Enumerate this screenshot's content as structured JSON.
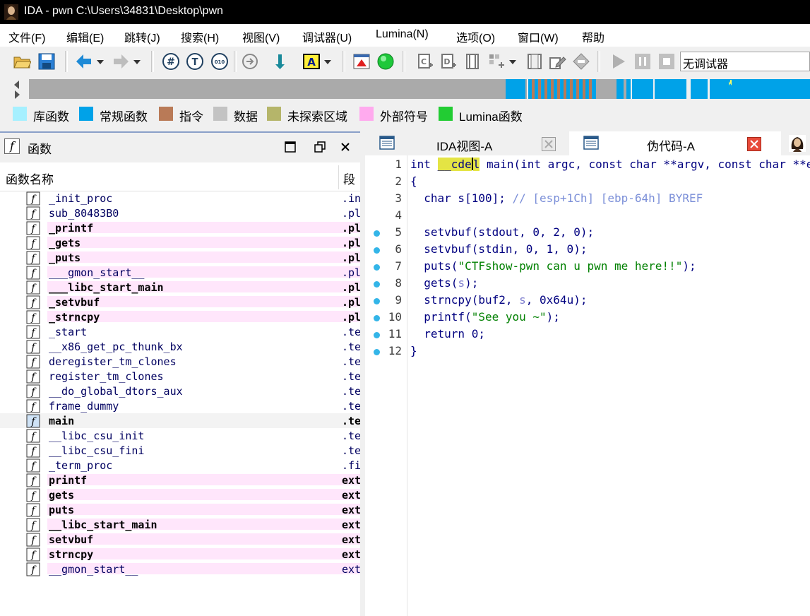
{
  "window": {
    "title": "IDA - pwn C:\\Users\\34831\\Desktop\\pwn"
  },
  "menu": [
    "文件(F)",
    "编辑(E)",
    "跳转(J)",
    "搜索(H)",
    "视图(V)",
    "调试器(U)",
    "Lumina(N)",
    "选项(O)",
    "窗口(W)",
    "帮助"
  ],
  "toolbar": {
    "debugger_select": "无调试器"
  },
  "legend": [
    {
      "label": "库函数",
      "color": "#a6f0ff"
    },
    {
      "label": "常规函数",
      "color": "#00a2e8"
    },
    {
      "label": "指令",
      "color": "#b97a57"
    },
    {
      "label": "数据",
      "color": "#c3c3c3"
    },
    {
      "label": "未探索区域",
      "color": "#b5b56a"
    },
    {
      "label": "外部符号",
      "color": "#ffaaee"
    },
    {
      "label": "Lumina函数",
      "color": "#22cc33"
    }
  ],
  "functions_panel": {
    "title": "函数",
    "col_name": "函数名称",
    "col_segment": "段",
    "rows": [
      {
        "name": "_init_proc",
        "segment": ".init"
      },
      {
        "name": "sub_80483B0",
        "segment": ".plt"
      },
      {
        "name": "_printf",
        "segment": ".plt"
      },
      {
        "name": "_gets",
        "segment": ".plt"
      },
      {
        "name": "_puts",
        "segment": ".plt"
      },
      {
        "name": "___gmon_start__",
        "segment": ".plt"
      },
      {
        "name": "___libc_start_main",
        "segment": ".plt"
      },
      {
        "name": "_setvbuf",
        "segment": ".plt"
      },
      {
        "name": "_strncpy",
        "segment": ".plt"
      },
      {
        "name": "_start",
        "segment": ".text"
      },
      {
        "name": "__x86_get_pc_thunk_bx",
        "segment": ".text"
      },
      {
        "name": "deregister_tm_clones",
        "segment": ".text"
      },
      {
        "name": "register_tm_clones",
        "segment": ".text"
      },
      {
        "name": "__do_global_dtors_aux",
        "segment": ".text"
      },
      {
        "name": "frame_dummy",
        "segment": ".text"
      },
      {
        "name": "main",
        "segment": ".text"
      },
      {
        "name": "__libc_csu_init",
        "segment": ".text"
      },
      {
        "name": "__libc_csu_fini",
        "segment": ".text"
      },
      {
        "name": "_term_proc",
        "segment": ".fini"
      },
      {
        "name": "printf",
        "segment": "extern"
      },
      {
        "name": "gets",
        "segment": "extern"
      },
      {
        "name": "puts",
        "segment": "extern"
      },
      {
        "name": "__libc_start_main",
        "segment": "extern"
      },
      {
        "name": "setvbuf",
        "segment": "extern"
      },
      {
        "name": "strncpy",
        "segment": "extern"
      },
      {
        "name": "__gmon_start__",
        "segment": "extern"
      }
    ]
  },
  "tabs": [
    {
      "label": "IDA视图-A"
    },
    {
      "label": "伪代码-A"
    }
  ],
  "pseudocode": {
    "line_numbers": [
      "1",
      "2",
      "3",
      "4",
      "5",
      "6",
      "7",
      "8",
      "9",
      "10",
      "11",
      "12"
    ],
    "l1_a": "int ",
    "l1_hl_a": "__cde",
    "l1_hl_b": "l",
    "l1_b": " main(int argc, const char **argv, const char **envp)",
    "l2": "{",
    "l3_a": "  char s[100]; ",
    "l3_c": "// [esp+1Ch] [ebp-64h] BYREF",
    "l5": "  setvbuf(stdout, 0, 2, 0);",
    "l6": "  setvbuf(stdin, 0, 1, 0);",
    "l7_a": "  puts(",
    "l7_s": "\"CTFshow-pwn can u pwn me here!!\"",
    "l7_b": ");",
    "l8_a": "  gets(",
    "l8_v": "s",
    "l8_b": ");",
    "l9_a": "  strncpy(buf2, ",
    "l9_v": "s",
    "l9_b": ", 0x64u);",
    "l10_a": "  printf(",
    "l10_s": "\"See you ~\"",
    "l10_b": ");",
    "l11": "  return 0;",
    "l12": "}"
  }
}
